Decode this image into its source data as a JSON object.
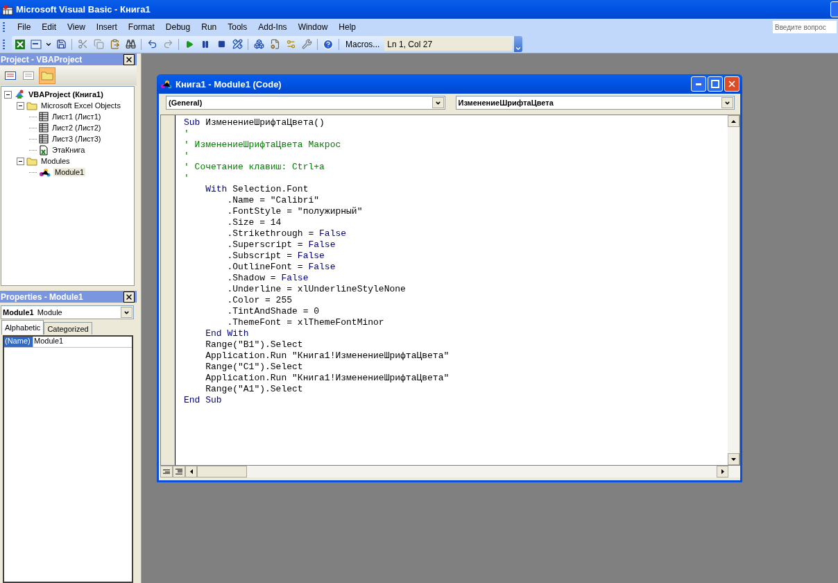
{
  "window": {
    "title": "Microsoft Visual Basic - Книга1"
  },
  "menu": [
    {
      "label": "File"
    },
    {
      "label": "Edit"
    },
    {
      "label": "View"
    },
    {
      "label": "Insert"
    },
    {
      "label": "Format"
    },
    {
      "label": "Debug"
    },
    {
      "label": "Run"
    },
    {
      "label": "Tools"
    },
    {
      "label": "Add-Ins"
    },
    {
      "label": "Window"
    },
    {
      "label": "Help"
    }
  ],
  "help_search": {
    "placeholder": "Введите вопрос"
  },
  "toolbar": {
    "macros": "Macros...",
    "position": "Ln 1, Col 27"
  },
  "project_panel": {
    "title": "Project - VBAProject",
    "tree": [
      {
        "label": "VBAProject (Книга1)",
        "kind": "project",
        "expanded": true,
        "selected": false,
        "children": [
          {
            "label": "Microsoft Excel Objects",
            "kind": "folder",
            "expanded": true,
            "selected": false,
            "children": [
              {
                "label": "Лист1 (Лист1)",
                "kind": "sheet",
                "selected": false
              },
              {
                "label": "Лист2 (Лист2)",
                "kind": "sheet",
                "selected": false
              },
              {
                "label": "Лист3 (Лист3)",
                "kind": "sheet",
                "selected": false
              },
              {
                "label": "ЭтаКнига",
                "kind": "workbook",
                "selected": false
              }
            ]
          },
          {
            "label": "Modules",
            "kind": "folder",
            "expanded": true,
            "selected": false,
            "children": [
              {
                "label": "Module1",
                "kind": "module",
                "selected": true
              }
            ]
          }
        ]
      }
    ]
  },
  "properties_panel": {
    "title": "Properties - Module1",
    "object_name": "Module1",
    "object_type": "Module",
    "tabs": [
      {
        "label": "Alphabetic",
        "selected": true
      },
      {
        "label": "Categorized",
        "selected": false
      }
    ],
    "rows": [
      {
        "name": "(Name)",
        "value": "Module1",
        "selected": true
      }
    ]
  },
  "code_window": {
    "title": "Книга1 - Module1 (Code)",
    "object_combo": "(General)",
    "procedure_combo": "ИзменениеШрифтаЦвета",
    "lines": [
      [
        {
          "kind": "keyword",
          "text": "Sub"
        },
        {
          "kind": "plain",
          "text": " ИзменениеШрифтаЦвета()"
        }
      ],
      [
        {
          "kind": "comment",
          "text": "'"
        }
      ],
      [
        {
          "kind": "comment",
          "text": "' ИзменениеШрифтаЦвета Макрос"
        }
      ],
      [
        {
          "kind": "comment",
          "text": "'"
        }
      ],
      [
        {
          "kind": "comment",
          "text": "' Сочетание клавиш: Ctrl+a"
        }
      ],
      [
        {
          "kind": "comment",
          "text": "'"
        }
      ],
      [
        {
          "kind": "keyword",
          "text": "    With"
        },
        {
          "kind": "plain",
          "text": " Selection.Font"
        }
      ],
      [
        {
          "kind": "plain",
          "text": "        .Name = \"Calibri\""
        }
      ],
      [
        {
          "kind": "plain",
          "text": "        .FontStyle = \"полужирный\""
        }
      ],
      [
        {
          "kind": "plain",
          "text": "        .Size = 14"
        }
      ],
      [
        {
          "kind": "plain",
          "text": "        .Strikethrough = "
        },
        {
          "kind": "keyword",
          "text": "False"
        }
      ],
      [
        {
          "kind": "plain",
          "text": "        .Superscript = "
        },
        {
          "kind": "keyword",
          "text": "False"
        }
      ],
      [
        {
          "kind": "plain",
          "text": "        .Subscript = "
        },
        {
          "kind": "keyword",
          "text": "False"
        }
      ],
      [
        {
          "kind": "plain",
          "text": "        .OutlineFont = "
        },
        {
          "kind": "keyword",
          "text": "False"
        }
      ],
      [
        {
          "kind": "plain",
          "text": "        .Shadow = "
        },
        {
          "kind": "keyword",
          "text": "False"
        }
      ],
      [
        {
          "kind": "plain",
          "text": "        .Underline = xlUnderlineStyleNone"
        }
      ],
      [
        {
          "kind": "plain",
          "text": "        .Color = 255"
        }
      ],
      [
        {
          "kind": "plain",
          "text": "        .TintAndShade = 0"
        }
      ],
      [
        {
          "kind": "plain",
          "text": "        .ThemeFont = xlThemeFontMinor"
        }
      ],
      [
        {
          "kind": "keyword",
          "text": "    End With"
        }
      ],
      [
        {
          "kind": "plain",
          "text": "    Range(\"B1\").Select"
        }
      ],
      [
        {
          "kind": "plain",
          "text": "    Application.Run \"Книга1!ИзменениеШрифтаЦвета\""
        }
      ],
      [
        {
          "kind": "plain",
          "text": "    Range(\"C1\").Select"
        }
      ],
      [
        {
          "kind": "plain",
          "text": "    Application.Run \"Книга1!ИзменениеШрифтаЦвета\""
        }
      ],
      [
        {
          "kind": "plain",
          "text": "    Range(\"A1\").Select"
        }
      ],
      [
        {
          "kind": "keyword",
          "text": "End Sub"
        }
      ]
    ]
  }
}
